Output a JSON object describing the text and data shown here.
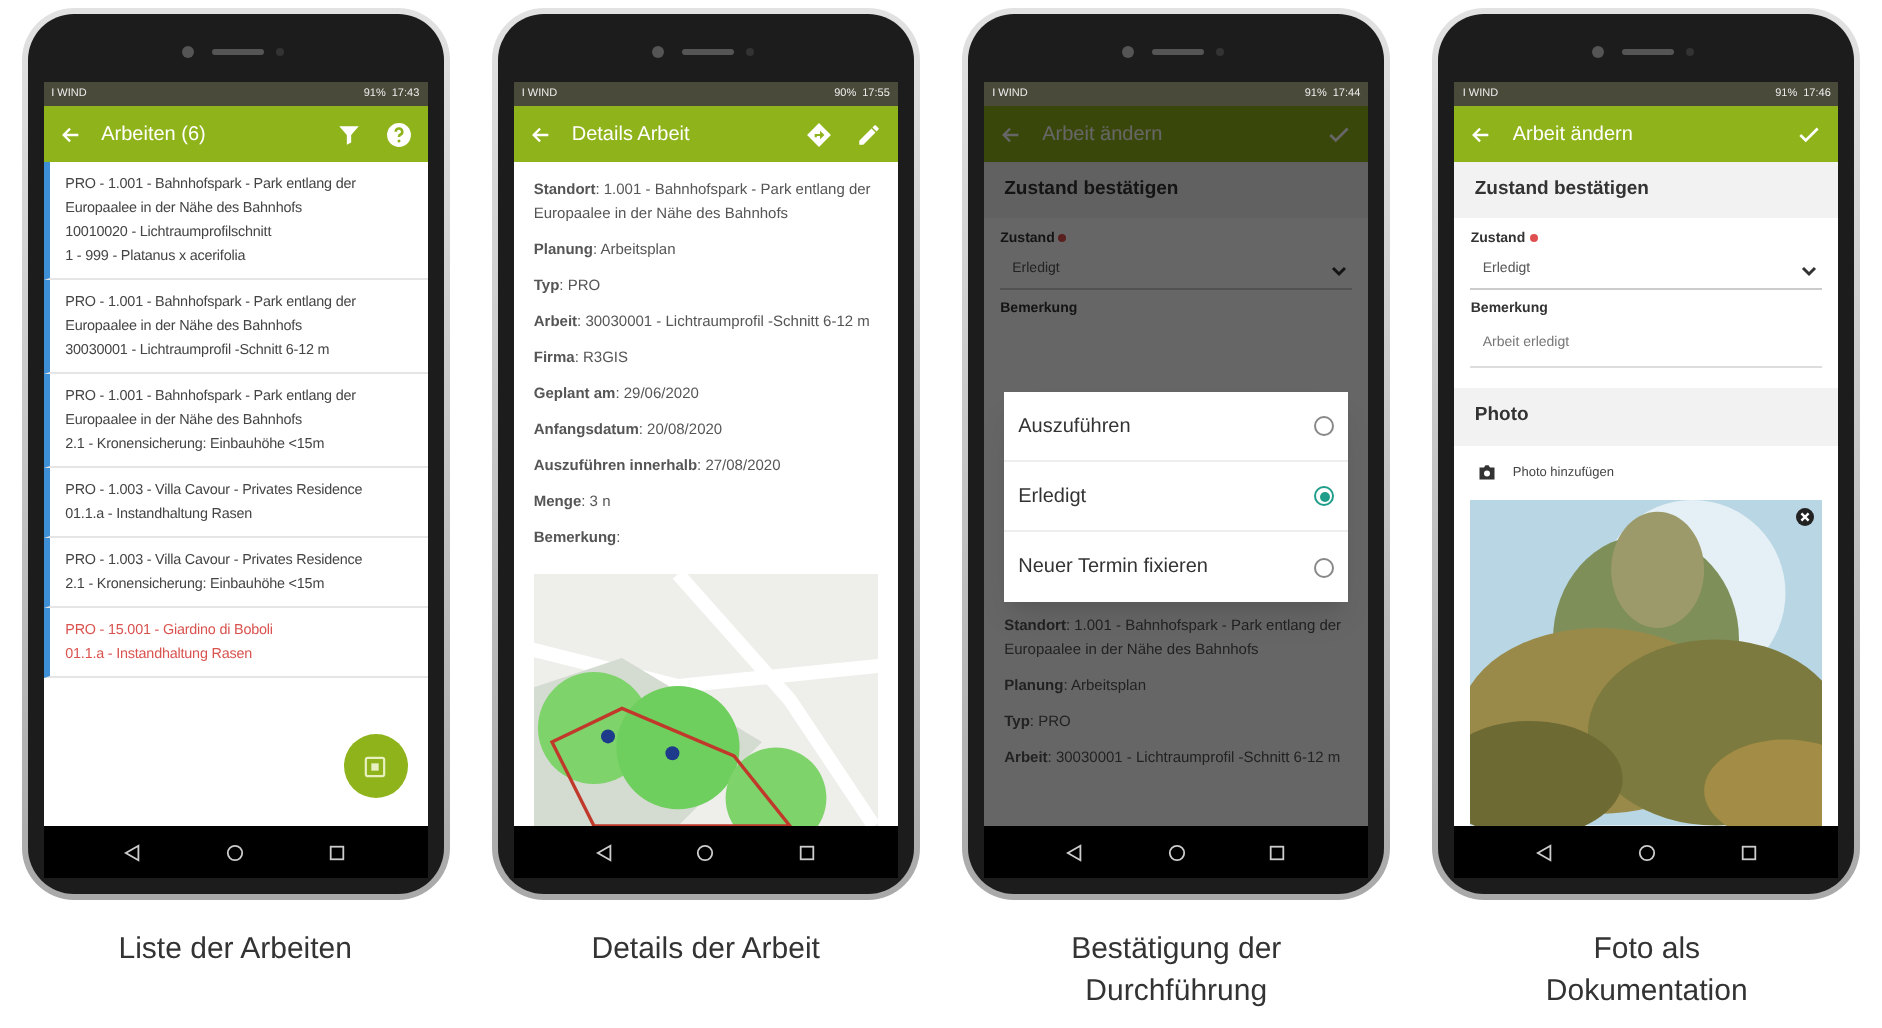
{
  "phones": [
    {
      "status": {
        "carrier": "I WIND",
        "battery": "91%",
        "time": "17:43"
      },
      "app_bar": {
        "title": "Arbeiten (6)",
        "actions": [
          {
            "kind": "filter"
          },
          {
            "kind": "help"
          }
        ]
      },
      "screen": {
        "kind": "list",
        "items": [
          {
            "lines": [
              "PRO - 1.001 - Bahnhofspark - Park entlang der",
              "Europaalee in der Nähe des Bahnhofs",
              "10010020 - Lichtraumprofilschnitt",
              "1 - 999 - Platanus x acerifolia"
            ],
            "overdue": false
          },
          {
            "lines": [
              "PRO - 1.001 - Bahnhofspark - Park entlang der",
              "Europaalee in der Nähe des Bahnhofs",
              "30030001 - Lichtraumprofil -Schnitt 6-12 m"
            ],
            "overdue": false
          },
          {
            "lines": [
              "PRO - 1.001 - Bahnhofspark - Park entlang der",
              "Europaalee in der Nähe des Bahnhofs",
              "2.1 - Kronensicherung: Einbauhöhe <15m"
            ],
            "overdue": false
          },
          {
            "lines": [
              "PRO - 1.003 - Villa Cavour - Privates Residence",
              "01.1.a - Instandhaltung Rasen"
            ],
            "overdue": false
          },
          {
            "lines": [
              "PRO - 1.003 - Villa Cavour - Privates Residence",
              "2.1 - Kronensicherung: Einbauhöhe <15m"
            ],
            "overdue": false
          },
          {
            "lines": [
              "PRO - 15.001 - Giardino di Boboli",
              "01.1.a - Instandhaltung Rasen"
            ],
            "overdue": true
          }
        ],
        "fab": true
      },
      "caption": [
        "Liste der Arbeiten"
      ]
    },
    {
      "status": {
        "carrier": "I WIND",
        "battery": "90%",
        "time": "17:55"
      },
      "app_bar": {
        "title": "Details Arbeit",
        "actions": [
          {
            "kind": "directions"
          },
          {
            "kind": "edit"
          }
        ]
      },
      "screen": {
        "kind": "details",
        "fields": [
          "**Standort**: 1.001 - Bahnhofspark - Park entlang der Europaalee in der Nähe des Bahnhofs",
          "**Planung**: Arbeitsplan",
          "**Typ**: PRO",
          "**Arbeit**: 30030001 - Lichtraumprofil -Schnitt 6-12 m",
          "**Firma**: R3GIS",
          "**Geplant am**: 29/06/2020",
          "**Anfangsdatum**: 20/08/2020",
          "**Auszuführen innerhalb**: 27/08/2020",
          "**Menge**: 3 n",
          "**Bemerkung**:"
        ]
      },
      "caption": [
        "Details der Arbeit"
      ]
    },
    {
      "status": {
        "carrier": "I WIND",
        "battery": "91%",
        "time": "17:44"
      },
      "app_bar": {
        "title": "Arbeit ändern",
        "actions": [
          {
            "kind": "confirm"
          }
        ]
      },
      "screen": {
        "kind": "edit",
        "section_title": "Zustand bestätigen",
        "state_field": {
          "label": "Zustand",
          "required": true,
          "value": "Erledigt"
        },
        "remark_field": {
          "label": "Bemerkung"
        },
        "details": [
          "**Standort**: 1.001 - Bahnhofspark - Park entlang der Europaalee in der Nähe des Bahnhofs",
          "**Planung**: Arbeitsplan",
          "**Typ**: PRO",
          "**Arbeit**: 30030001 - Lichtraumprofil -Schnitt 6-12 m"
        ],
        "dialog": {
          "options": [
            {
              "label": "Auszuführen",
              "selected": false
            },
            {
              "label": "Erledigt",
              "selected": true
            },
            {
              "label": "Neuer Termin fixieren",
              "selected": false
            }
          ]
        }
      },
      "caption": [
        "Bestätigung der",
        "Durchführung"
      ]
    },
    {
      "status": {
        "carrier": "I WIND",
        "battery": "91%",
        "time": "17:46"
      },
      "app_bar": {
        "title": "Arbeit ändern",
        "actions": [
          {
            "kind": "confirm"
          }
        ]
      },
      "screen": {
        "kind": "edit",
        "section_title": "Zustand bestätigen",
        "state_field": {
          "label": "Zustand",
          "required": true,
          "value": "Erledigt"
        },
        "remark_field": {
          "label": "Bemerkung",
          "value": "Arbeit erledigt"
        },
        "photo_section": {
          "title": "Photo",
          "add_label": "Photo hinzufügen"
        }
      },
      "caption": [
        "Foto als",
        "Dokumentation"
      ]
    }
  ]
}
